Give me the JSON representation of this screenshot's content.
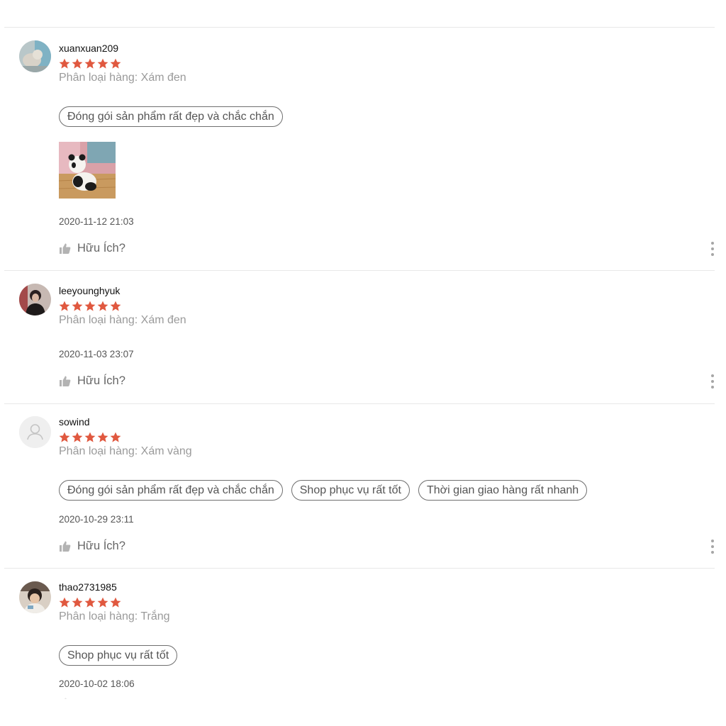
{
  "reviews": [
    {
      "username": "xuanxuan209",
      "rating": 5,
      "variation": "Phân loại hàng: Xám đen",
      "tags": [
        "Đóng gói sản phẩm rất đẹp và chắc chắn"
      ],
      "timestamp": "2020-11-12 21:03",
      "helpful_label": "Hữu Ích?"
    },
    {
      "username": "leeyounghyuk",
      "rating": 5,
      "variation": "Phân loại hàng: Xám đen",
      "tags": [],
      "timestamp": "2020-11-03 23:07",
      "helpful_label": "Hữu Ích?"
    },
    {
      "username": "sowind",
      "rating": 5,
      "variation": "Phân loại hàng: Xám vàng",
      "tags": [
        "Đóng gói sản phẩm rất đẹp và chắc chắn",
        "Shop phục vụ rất tốt",
        "Thời gian giao hàng rất nhanh"
      ],
      "timestamp": "2020-10-29 23:11",
      "helpful_label": "Hữu Ích?"
    },
    {
      "username": "thao2731985",
      "rating": 5,
      "variation": "Phân loại hàng: Trắng",
      "tags": [
        "Shop phục vụ rất tốt"
      ],
      "timestamp": "2020-10-02 18:06",
      "helpful_label": ""
    }
  ],
  "colors": {
    "star": "#e0583f",
    "divider": "#e8e8e8",
    "muted_text": "#9a9a9a"
  },
  "icons": {
    "rating": "star-icon",
    "helpful": "thumbs-up-icon",
    "more": "more-vertical-icon",
    "default_avatar": "user-icon"
  }
}
